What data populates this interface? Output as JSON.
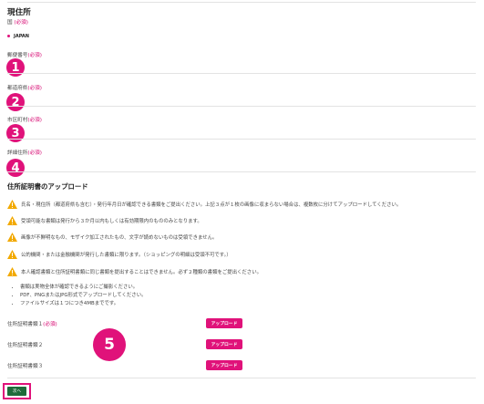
{
  "section_title": "現住所",
  "required_label": "(必須)",
  "fields": {
    "country": {
      "label": "国",
      "value": "JAPAN"
    },
    "postal_code": {
      "label": "郵便番号"
    },
    "prefecture": {
      "label": "都道府県"
    },
    "city": {
      "label": "市区町村"
    },
    "address_detail": {
      "label": "詳細住所"
    }
  },
  "markers": [
    "1",
    "2",
    "3",
    "4",
    "5"
  ],
  "upload_section": {
    "title": "住所証明書のアップロード",
    "warnings": [
      "氏名・現住所（都道府県も含む）・発行年月日が確認できる書類をご提出ください。上記３点が１枚の画像に収まらない場合は、複数枚に分けてアップロードしてください。",
      "受領可能な書類は発行から３か月以内もしくは有効期限内のもののみとなります。",
      "画像が不鮮明なもの、モザイク加工されたもの、文字が読めないものは受領できません。",
      "公的機関・または金融機関が発行した書類に限ります。（ショッピングの明細は受領不可です。）",
      "本人確認書類と住所証明書類に同じ書類を提出することはできません。必ず２種類の書類をご提出ください。"
    ],
    "notes": [
      "書類は実物全体が確認できるようにご撮影ください。",
      "PDF、PNGまたはJPG形式でアップロードしてください。",
      "ファイルサイズは１つにつき4MBまでです。"
    ],
    "files": [
      {
        "label": "住所証明書類１",
        "required": "(必須)",
        "button": "アップロード"
      },
      {
        "label": "住所証明書類２",
        "button": "アップロード"
      },
      {
        "label": "住所証明書類３",
        "button": "アップロード"
      }
    ]
  },
  "next_button": "次へ",
  "colors": {
    "accent": "#e0127a",
    "next": "#1f6b3a",
    "warning": "#f2a900"
  }
}
